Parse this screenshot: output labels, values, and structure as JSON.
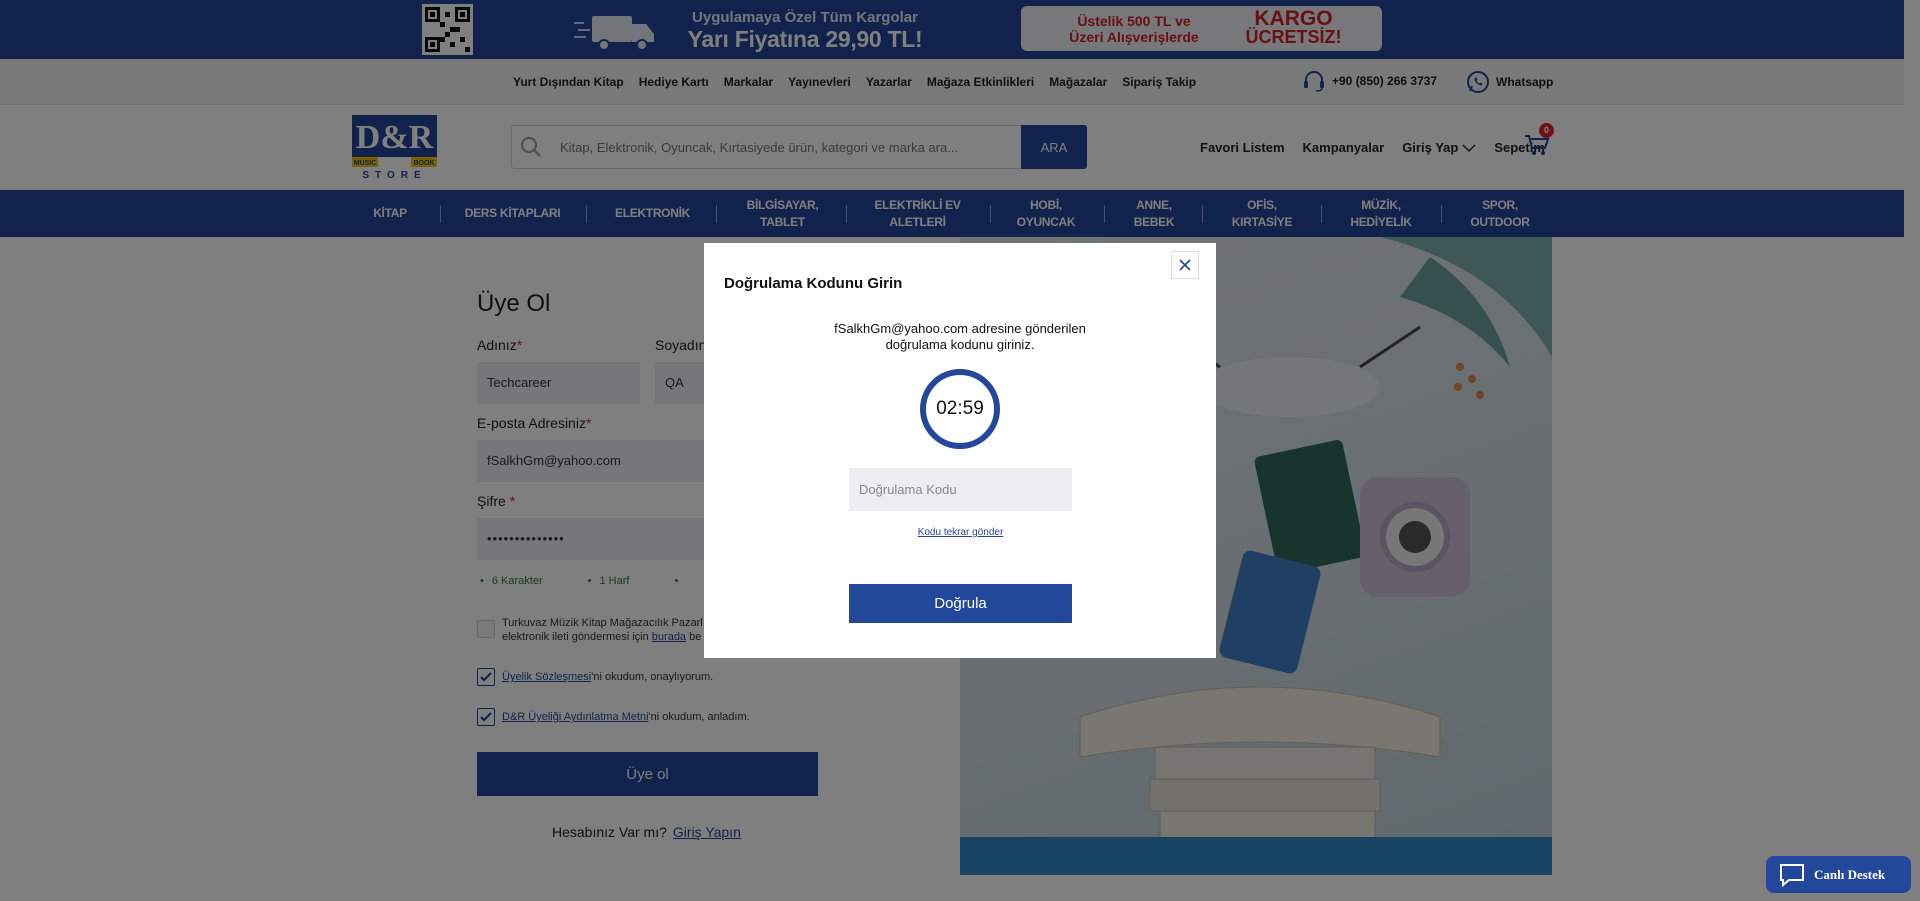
{
  "promo": {
    "line1": "Uygulamaya Özel Tüm Kargolar",
    "line2": "Yarı Fiyatına 29,90 TL!",
    "card_left_1": "Üstelik 500 TL ve",
    "card_left_2": "Üzeri Alışverişlerde",
    "card_right_1": "KARGO",
    "card_right_2": "ÜCRETSİZ!"
  },
  "utility": {
    "links": [
      "Yurt Dışından Kitap",
      "Hediye Kartı",
      "Markalar",
      "Yayınevleri",
      "Yazarlar",
      "Mağaza Etkinlikleri",
      "Mağazalar",
      "Sipariş Takip"
    ],
    "phone": "+90 (850) 266 3737",
    "whatsapp": "Whatsapp"
  },
  "header": {
    "logo_top": "D&R",
    "logo_left": "MUSIC",
    "logo_right": "BOOK",
    "logo_bottom": "STORE",
    "search_placeholder": "Kitap, Elektronik, Oyuncak, Kırtasiyede ürün, kategori ve marka ara...",
    "search_button": "ARA",
    "favorites": "Favori Listem",
    "campaigns": "Kampanyalar",
    "login": "Giriş Yap",
    "cart": "Sepetim",
    "cart_count": "0"
  },
  "categories": [
    {
      "l1": "KİTAP",
      "l2": ""
    },
    {
      "l1": "DERS KİTAPLARI",
      "l2": ""
    },
    {
      "l1": "ELEKTRONİK",
      "l2": ""
    },
    {
      "l1": "BİLGİSAYAR,",
      "l2": "TABLET"
    },
    {
      "l1": "ELEKTRİKLİ EV",
      "l2": "ALETLERİ"
    },
    {
      "l1": "HOBİ,",
      "l2": "OYUNCAK"
    },
    {
      "l1": "ANNE,",
      "l2": "BEBEK"
    },
    {
      "l1": "OFİS,",
      "l2": "KIRTASİYE"
    },
    {
      "l1": "MÜZİK,",
      "l2": "HEDİYELİK"
    },
    {
      "l1": "SPOR,",
      "l2": "OUTDOOR"
    }
  ],
  "form": {
    "title": "Üye Ol",
    "first_name_label": "Adınız",
    "first_name_value": "Techcareer",
    "last_name_label": "Soyadın",
    "last_name_value": "QA",
    "email_label": "E-posta Adresiniz",
    "email_value": "fSalkhGm@yahoo.com",
    "password_label": "Şifre",
    "password_value": "••••••••••••••",
    "rules": [
      "6 Karakter",
      "1 Harf",
      ""
    ],
    "consent_line1": "Turkuvaz Müzik Kitap Mağazacılık Pazarl",
    "consent_line2_pre": "elektronik ileti göndermesi için ",
    "consent_link": "burada",
    "consent_line2_post": " be",
    "membership_link": "Üyelik Sözleşmesi",
    "membership_text": "'ni okudum, onaylıyorum.",
    "privacy_link": "D&R Üyeliği Aydınlatma Metni",
    "privacy_text": "'ni okudum, anladım.",
    "submit": "Üye ol",
    "have_account": "Hesabınız Var mı?",
    "login_link": "Giriş Yapın"
  },
  "modal": {
    "title": "Doğrulama Kodunu Girin",
    "desc_line1": "fSalkhGm@yahoo.com adresine gönderilen",
    "desc_line2": "doğrulama kodunu giriniz.",
    "timer": "02:59",
    "code_placeholder": "Doğrulama Kodu",
    "resend": "Kodu tekrar gönder",
    "verify": "Doğrula"
  },
  "live_support": "Canlı Destek",
  "colors": {
    "brand": "#23479a",
    "accent_red": "#d21f2b"
  }
}
